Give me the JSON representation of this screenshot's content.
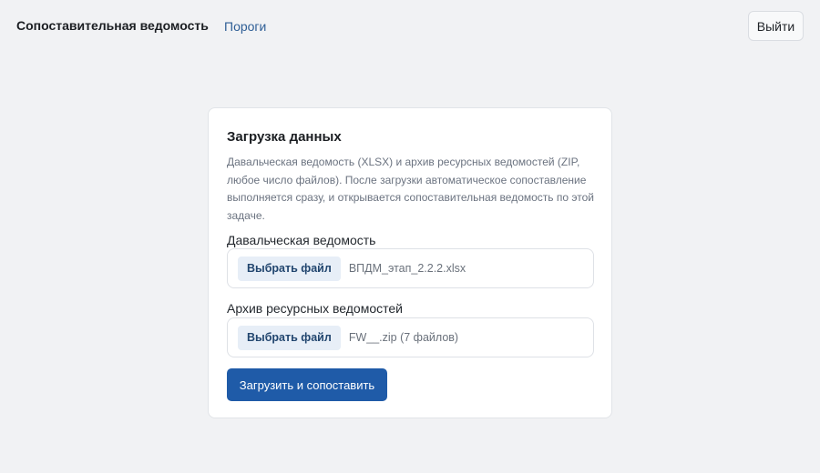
{
  "header": {
    "brand": "Сопоставительная ведомость",
    "nav_link": "Пороги",
    "logout_label": "Выйти"
  },
  "card": {
    "title": "Загрузка данных",
    "description": "Давальческая ведомость (XLSX) и архив ресурсных ведомостей (ZIP, любое число файлов). После загрузки автоматическое сопоставление выполняется сразу, и открывается сопоставительная ведомость по этой задаче.",
    "field1": {
      "label": "Давальческая ведомость",
      "button_label": "Выбрать файл",
      "file_name": "ВПДМ_этап_2.2.2.xlsx"
    },
    "field2": {
      "label": "Архив ресурсных ведомостей",
      "button_label": "Выбрать файл",
      "file_name": "FW__.zip (7 файлов)"
    },
    "submit_label": "Загрузить и сопоставить"
  },
  "colors": {
    "accent": "#1f5ba8",
    "link": "#2f5f96",
    "background": "#f1f2f4",
    "card": "#ffffff"
  }
}
